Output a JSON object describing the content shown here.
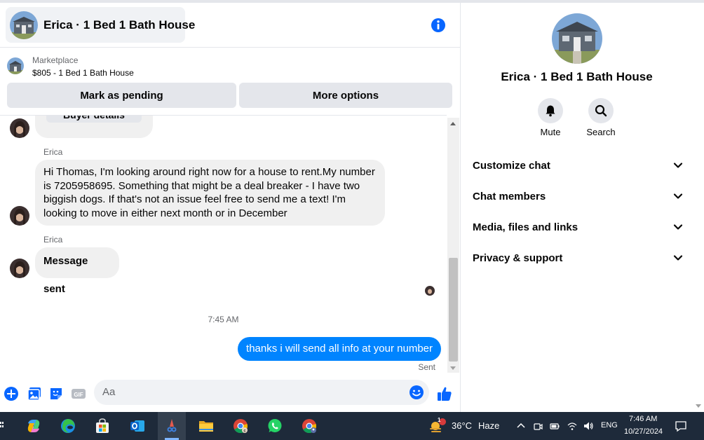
{
  "chat": {
    "title": "Erica · 1 Bed 1 Bath House",
    "marketplace_label": "Marketplace",
    "listing": "$805 - 1 Bed 1 Bath House",
    "actions": {
      "mark_pending": "Mark as pending",
      "more_options": "More options"
    },
    "partial_button": "Buyer details",
    "messages": [
      {
        "sender": "Erica",
        "text": "Hi Thomas, I'm looking around right now for a house to rent.My number is 7205958695. Something that might be a deal breaker - I have two biggish dogs. If that's not an issue feel free to send me a text! I'm looking to move in either next month or in December"
      },
      {
        "sender": "Erica",
        "text": "Message sent"
      }
    ],
    "timestamp": "7:45 AM",
    "outgoing": {
      "text": "thanks i will send all info at your number",
      "status": "Sent"
    },
    "composer_placeholder": "Aa"
  },
  "info": {
    "title": "Erica · 1 Bed 1 Bath House",
    "mute_label": "Mute",
    "search_label": "Search",
    "sections": [
      "Customize chat",
      "Chat members",
      "Media, files and links",
      "Privacy & support"
    ]
  },
  "taskbar": {
    "weather_temp": "36°C",
    "weather_desc": "Haze",
    "weather_badge": "1",
    "language": "ENG",
    "time": "7:46 AM",
    "date": "10/27/2024"
  },
  "colors": {
    "accent": "#0084ff",
    "info_blue": "#0866ff",
    "bubble_in": "#f0f0f0",
    "taskbar": "#1e2a3a"
  }
}
